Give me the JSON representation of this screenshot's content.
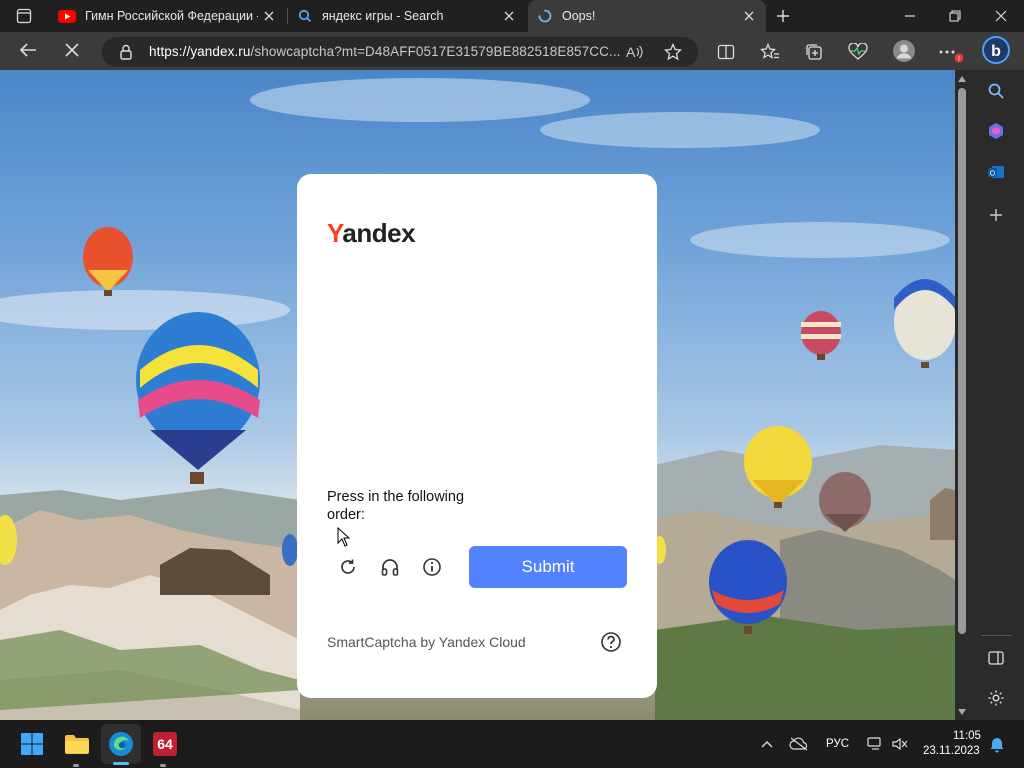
{
  "tabs": [
    {
      "title": "Гимн Российской Федерации -",
      "icon": "youtube-icon"
    },
    {
      "title": "яндекс игры - Search",
      "icon": "bing-search-icon"
    },
    {
      "title": "Oops!",
      "icon": "loading-spinner-icon"
    }
  ],
  "address": {
    "url_host": "https://yandex.ru",
    "url_path": "/showcaptcha?mt=D48AFF0517E31579BE882518E857CC..."
  },
  "captcha": {
    "logo_first": "Y",
    "logo_rest": "andex",
    "instruction": "Press in the following order:",
    "submit_label": "Submit",
    "brand": "SmartCaptcha by Yandex Cloud"
  },
  "taskbar": {
    "language": "РУС",
    "time": "11:05",
    "date": "23.11.2023",
    "app_badge": "64"
  },
  "colors": {
    "accent_submit": "#5282ff",
    "yandex_red": "#fc3f1d",
    "browser_dark": "#202020"
  }
}
